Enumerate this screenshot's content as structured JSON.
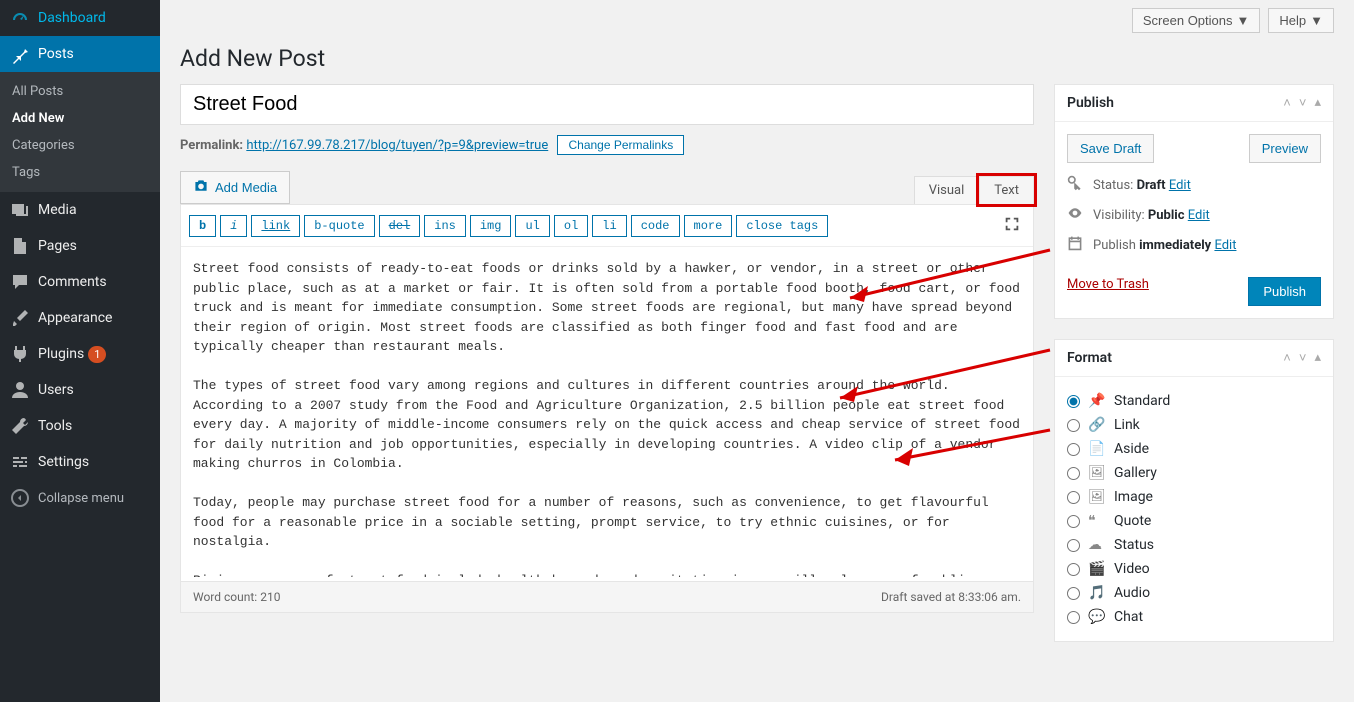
{
  "top": {
    "screen_options": "Screen Options",
    "help": "Help"
  },
  "sidebar": {
    "items": [
      {
        "label": "Dashboard"
      },
      {
        "label": "Posts"
      },
      {
        "label": "Media"
      },
      {
        "label": "Pages"
      },
      {
        "label": "Comments"
      },
      {
        "label": "Appearance"
      },
      {
        "label": "Plugins",
        "badge": "1"
      },
      {
        "label": "Users"
      },
      {
        "label": "Tools"
      },
      {
        "label": "Settings"
      }
    ],
    "posts_sub": [
      {
        "label": "All Posts"
      },
      {
        "label": "Add New"
      },
      {
        "label": "Categories"
      },
      {
        "label": "Tags"
      }
    ],
    "collapse": "Collapse menu"
  },
  "page": {
    "title": "Add New Post"
  },
  "post": {
    "title": "Street Food",
    "permalink_label": "Permalink:",
    "permalink_url": "http://167.99.78.217/blog/tuyen/?p=9&preview=true",
    "change_permalinks": "Change Permalinks",
    "add_media": "Add Media",
    "tabs": {
      "visual": "Visual",
      "text": "Text"
    },
    "toolbar": [
      "b",
      "i",
      "link",
      "b-quote",
      "del",
      "ins",
      "img",
      "ul",
      "ol",
      "li",
      "code",
      "more",
      "close tags"
    ],
    "content": "Street food consists of ready-to-eat foods or drinks sold by a hawker, or vendor, in a street or other public place, such as at a market or fair. It is often sold from a portable food booth, food cart, or food truck and is meant for immediate consumption. Some street foods are regional, but many have spread beyond their region of origin. Most street foods are classified as both finger food and fast food and are typically cheaper than restaurant meals.\n\nThe types of street food vary among regions and cultures in different countries around the world. According to a 2007 study from the Food and Agriculture Organization, 2.5 billion people eat street food every day. A majority of middle-income consumers rely on the quick access and cheap service of street food for daily nutrition and job opportunities, especially in developing countries. A video clip of a vendor making churros in Colombia.\n\nToday, people may purchase street food for a number of reasons, such as convenience, to get flavourful food for a reasonable price in a sociable setting, prompt service, to try ethnic cuisines, or for nostalgia.\n\nRising concerns of street food include health hazards and sanitation issues, illegal usage of public or private areas, social and ethical problems, and traffic congestion.",
    "word_count_label": "Word count:",
    "word_count": "210",
    "draft_saved": "Draft saved at 8:33:06 am."
  },
  "publish": {
    "title": "Publish",
    "save_draft": "Save Draft",
    "preview": "Preview",
    "status_label": "Status:",
    "status_value": "Draft",
    "visibility_label": "Visibility:",
    "visibility_value": "Public",
    "publish_label": "Publish",
    "publish_value": "immediately",
    "edit": "Edit",
    "move_trash": "Move to Trash",
    "publish_btn": "Publish"
  },
  "format": {
    "title": "Format",
    "options": [
      "Standard",
      "Link",
      "Aside",
      "Gallery",
      "Image",
      "Quote",
      "Status",
      "Video",
      "Audio",
      "Chat"
    ]
  }
}
